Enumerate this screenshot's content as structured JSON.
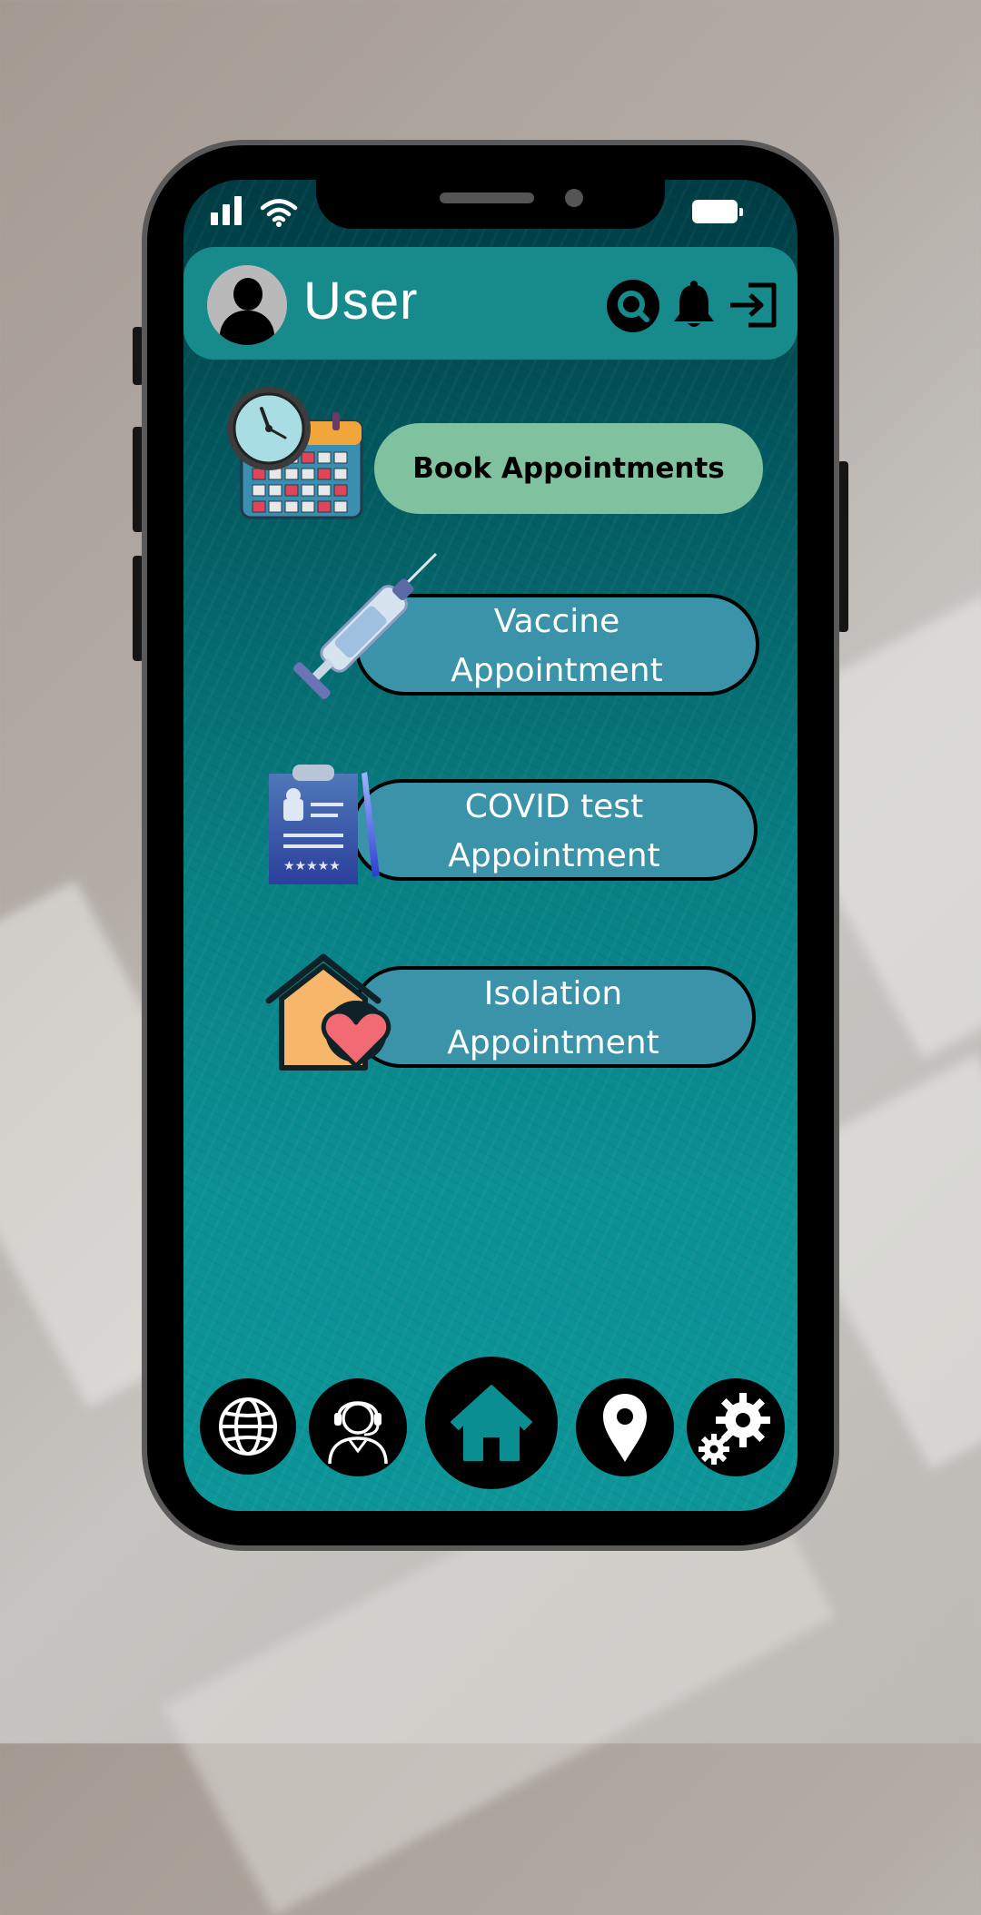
{
  "header": {
    "user_name": "User",
    "icons": [
      "search-icon",
      "bell-icon",
      "logout-icon"
    ]
  },
  "main": {
    "book_label": "Book Appointments",
    "appointments": [
      {
        "line1": "Vaccine",
        "line2": "Appointment",
        "icon": "syringe-icon"
      },
      {
        "line1": "COVID test",
        "line2": "Appointment",
        "icon": "clipboard-icon"
      },
      {
        "line1": "Isolation",
        "line2": "Appointment",
        "icon": "house-heart-icon"
      }
    ]
  },
  "bottom_nav": [
    "globe-icon",
    "support-agent-icon",
    "home-icon",
    "location-pin-icon",
    "settings-gears-icon"
  ],
  "colors": {
    "header_bg": "#178a8c",
    "book_button": "#80c2a0",
    "appointment_button": "#3a93a9",
    "screen_top": "#003b43",
    "screen_bottom": "#0c9699"
  }
}
